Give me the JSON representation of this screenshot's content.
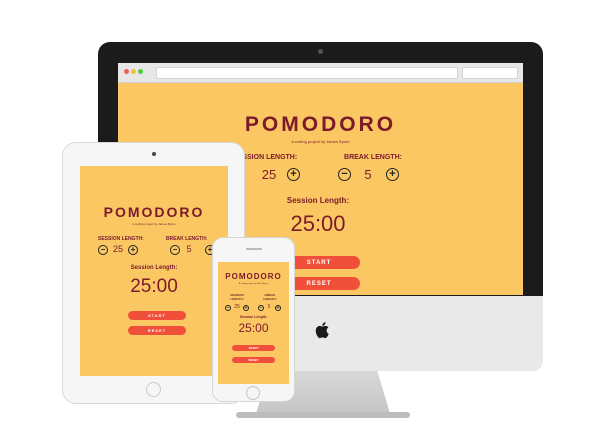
{
  "app": {
    "title": "POMODORO",
    "subtitle": "A coding project by James Byrne",
    "session_label": "SESSION LENGTH:",
    "break_label": "BREAK LENGTH:",
    "session_value": "25",
    "break_value": "5",
    "timer_label": "Session Length:",
    "timer_value": "25:00",
    "start_label": "START",
    "reset_label": "RESET",
    "minus": "−",
    "plus": "+"
  },
  "phone_labels": {
    "session_line1": "SESSION",
    "session_line2": "LENGTH:",
    "break_line1": "BREAK",
    "break_line2": "LENGTH:"
  },
  "colors": {
    "background": "#fbc763",
    "text": "#7a1a2b",
    "button": "#f0503a"
  },
  "icons": {
    "apple": "apple-logo-icon",
    "minus": "minus-circle-icon",
    "plus": "plus-circle-icon"
  }
}
